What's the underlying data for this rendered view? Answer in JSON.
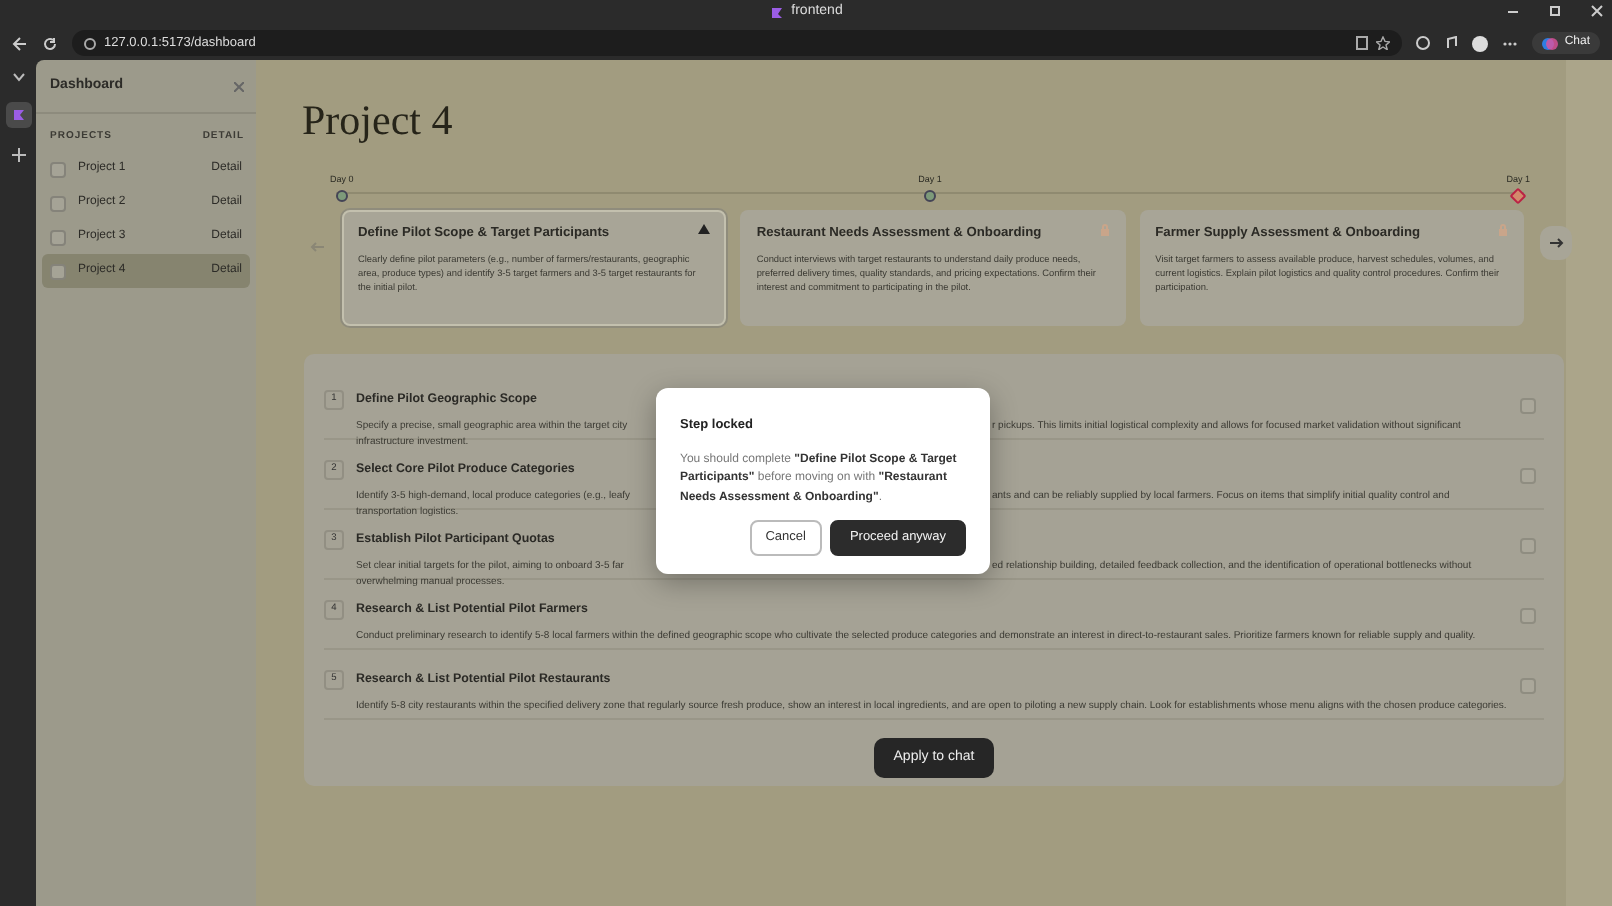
{
  "browser": {
    "tab_title": "frontend",
    "url": "127.0.0.1:5173/dashboard",
    "chat_button": "Chat"
  },
  "sidebar": {
    "title": "Dashboard",
    "columns": [
      "PROJECTS",
      "DETAIL"
    ],
    "projects": [
      {
        "name": "Project 1",
        "detail": "Detail",
        "checked": false,
        "selected": false
      },
      {
        "name": "Project 2",
        "detail": "Detail",
        "checked": false,
        "selected": false
      },
      {
        "name": "Project 3",
        "detail": "Detail",
        "checked": false,
        "selected": false
      },
      {
        "name": "Project 4",
        "detail": "Detail",
        "checked": false,
        "selected": true
      }
    ]
  },
  "page": {
    "title": "Project 4",
    "timeline": [
      {
        "label": "Day 0",
        "kind": "done"
      },
      {
        "label": "Day 1",
        "kind": "done"
      },
      {
        "label": "Day 1",
        "kind": "alert"
      }
    ],
    "steps": [
      {
        "title": "Define Pilot Scope & Target Participants",
        "description": "Clearly define pilot parameters (e.g., number of farmers/restaurants, geographic area, produce types) and identify 3-5 target farmers and 3-5 target restaurants for the initial pilot.",
        "selected": true,
        "locked": false
      },
      {
        "title": "Restaurant Needs Assessment & Onboarding",
        "description": "Conduct interviews with target restaurants to understand daily produce needs, preferred delivery times, quality standards, and pricing expectations. Confirm their interest and commitment to participating in the pilot.",
        "selected": false,
        "locked": true
      },
      {
        "title": "Farmer Supply Assessment & Onboarding",
        "description": "Visit target farmers to assess available produce, harvest schedules, volumes, and current logistics. Explain pilot logistics and quality control procedures. Confirm their participation.",
        "selected": false,
        "locked": true
      }
    ],
    "tasks": [
      {
        "number": "1",
        "title": "Define Pilot Geographic Scope",
        "lines": [
          [
            "Specify a precise, small geographic area within the target city",
            "r pickups. This limits initial logistical complexity and allows for focused market validation without significant"
          ],
          [
            "infrastructure investment."
          ]
        ],
        "checked": false
      },
      {
        "number": "2",
        "title": "Select Core Pilot Produce Categories",
        "lines": [
          [
            "Identify 3-5 high-demand, local produce categories (e.g., leafy",
            "ants and can be reliably supplied by local farmers. Focus on items that simplify initial quality control and"
          ],
          [
            "transportation logistics."
          ]
        ],
        "checked": false
      },
      {
        "number": "3",
        "title": "Establish Pilot Participant Quotas",
        "lines": [
          [
            "Set clear initial targets for the pilot, aiming to onboard 3-5 far",
            "ed relationship building, detailed feedback collection, and the identification of operational bottlenecks without"
          ],
          [
            "overwhelming manual processes."
          ]
        ],
        "checked": false
      },
      {
        "number": "4",
        "title": "Research & List Potential Pilot Farmers",
        "description": "Conduct preliminary research to identify 5-8 local farmers within the defined geographic scope who cultivate the selected produce categories and demonstrate an interest in direct-to-restaurant sales. Prioritize farmers known for reliable supply and quality.",
        "checked": false
      },
      {
        "number": "5",
        "title": "Research & List Potential Pilot Restaurants",
        "description": "Identify 5-8 city restaurants within the specified delivery zone that regularly source fresh produce, show an interest in local ingredients, and are open to piloting a new supply chain. Look for establishments whose menu aligns with the chosen produce categories.",
        "checked": false
      }
    ],
    "apply_button": "Apply to chat"
  },
  "dialog": {
    "title": "Step locked",
    "message": "You should complete **\"Define Pilot Scope & Target Participants\"** before moving on with **\"Restaurant Needs Assessment & Onboarding\"**.",
    "buttons": [
      {
        "label": "Cancel",
        "kind": "secondary"
      },
      {
        "label": "Proceed anyway",
        "kind": "primary"
      }
    ]
  }
}
